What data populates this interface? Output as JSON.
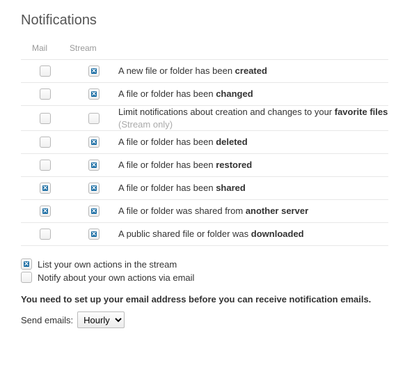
{
  "title": "Notifications",
  "columns": {
    "mail": "Mail",
    "stream": "Stream"
  },
  "rows": [
    {
      "mail": false,
      "stream": true,
      "text": "A new file or folder has been ",
      "bold": "created"
    },
    {
      "mail": false,
      "stream": true,
      "text": "A file or folder has been ",
      "bold": "changed"
    },
    {
      "mail": false,
      "stream": false,
      "text": "Limit notifications about creation and changes to your ",
      "bold": "favorite files",
      "suffix": " (Stream only)",
      "suffix_muted": true
    },
    {
      "mail": false,
      "stream": true,
      "text": "A file or folder has been ",
      "bold": "deleted"
    },
    {
      "mail": false,
      "stream": true,
      "text": "A file or folder has been ",
      "bold": "restored"
    },
    {
      "mail": true,
      "stream": true,
      "text": "A file or folder has been ",
      "bold": "shared"
    },
    {
      "mail": true,
      "stream": true,
      "text": "A file or folder was shared from ",
      "bold": "another server"
    },
    {
      "mail": false,
      "stream": true,
      "text": "A public shared file or folder was ",
      "bold": "downloaded"
    }
  ],
  "opt_list_own": {
    "checked": true,
    "label": "List your own actions in the stream"
  },
  "opt_notify_own": {
    "checked": false,
    "label": "Notify about your own actions via email"
  },
  "warning": "You need to set up your email address before you can receive notification emails.",
  "send_label": "Send emails:",
  "send_value": "Hourly"
}
